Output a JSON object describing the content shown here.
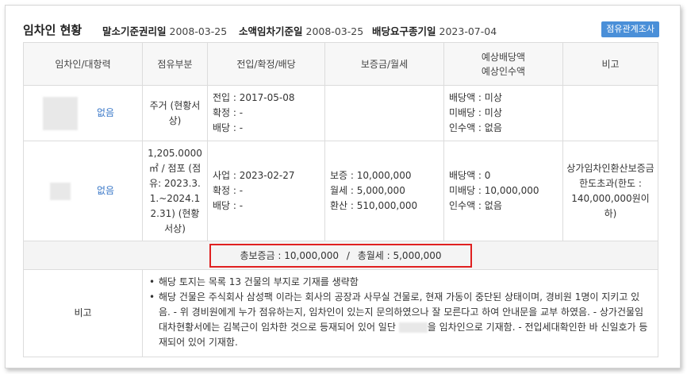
{
  "header": {
    "title": "임차인 현황",
    "items": [
      {
        "label": "말소기준권리일",
        "value": "2008-03-25"
      },
      {
        "label": "소액임차기준일",
        "value": "2008-03-25"
      },
      {
        "label": "배당요구종기일",
        "value": "2023-07-04"
      }
    ],
    "button_label": "점유관계조사"
  },
  "columns": {
    "tenant": "임차인/대항력",
    "occupancy": "점유부분",
    "move_in": "전입/확정/배당",
    "deposit": "보증금/월세",
    "expected_line1": "예상배당액",
    "expected_line2": "예상인수액",
    "note": "비고"
  },
  "rows": [
    {
      "opposing_power": "없음",
      "occupancy": "주거 (현황서상)",
      "move_in": [
        "전입 : 2017-05-08",
        "확정 : -",
        "배당 : -"
      ],
      "deposit": [],
      "expected": [
        "배당액 : 미상",
        "미배당 : 미상",
        "인수액 : 없음"
      ],
      "note": ""
    },
    {
      "opposing_power": "없음",
      "occupancy": "1,205.0000㎡ / 점포 (점유: 2023.3.1.~2024.12.31) (현황서상)",
      "move_in": [
        "사업 : 2023-02-27",
        "확정 : -",
        "배당 : -"
      ],
      "deposit": [
        "보증 : 10,000,000",
        "월세 : 5,000,000",
        "환산 : 510,000,000"
      ],
      "expected": [
        "배당액 : 0",
        "미배당 : 10,000,000",
        "인수액 : 없음"
      ],
      "note": "상가임차인환산보증금 한도초과(한도 : 140,000,000원이하)"
    }
  ],
  "summary": {
    "total_deposit": "총보증금 : 10,000,000",
    "separator": "/",
    "total_monthly": "총월세 : 5,000,000"
  },
  "remarks": {
    "label": "비고",
    "items": [
      "해당 토지는 목록 13 건물의 부지로 기재를 생략함",
      "해당 건물은 주식회사 삼성팩 이라는 회사의 공장과 사무실 건물로, 현재 가동이 중단된 상태이며, 경비원 1명이 지키고 있음. - 위 경비원에게 누가 점유하는지, 임차인이 있는지 문의하였으나 잘 모른다고 하여 안내문을 교부 하였음. - 상가건물임대차현황서에는 김복근이 임차한 것으로 등재되어 있어 일단 ",
      "을 임차인으로 기재함. - 전입세대확인한 바 신일호가 등재되어 있어 기재함."
    ]
  },
  "colors": {
    "accent_button": "#4a8fd8",
    "link": "#3a78c8",
    "highlight_border": "#e02020"
  }
}
